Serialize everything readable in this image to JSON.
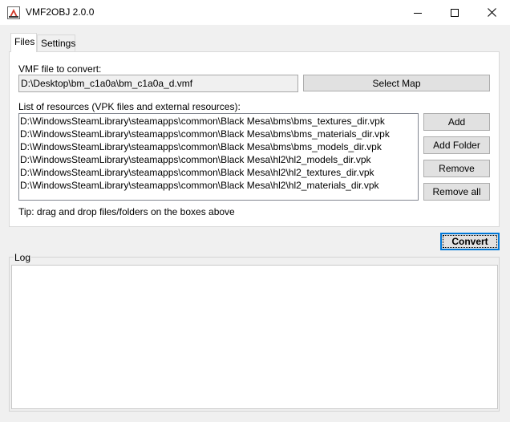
{
  "window": {
    "title": "VMF2OBJ 2.0.0"
  },
  "tabs": [
    {
      "label": "Files"
    },
    {
      "label": "Settings"
    }
  ],
  "files": {
    "vmf_label": "VMF file to convert:",
    "vmf_value": "D:\\Desktop\\bm_c1a0a\\bm_c1a0a_d.vmf",
    "select_map_label": "Select Map",
    "resources_label": "List of resources (VPK files and external resources):",
    "resources": [
      "D:\\WindowsSteamLibrary\\steamapps\\common\\Black Mesa\\bms\\bms_textures_dir.vpk",
      "D:\\WindowsSteamLibrary\\steamapps\\common\\Black Mesa\\bms\\bms_materials_dir.vpk",
      "D:\\WindowsSteamLibrary\\steamapps\\common\\Black Mesa\\bms\\bms_models_dir.vpk",
      "D:\\WindowsSteamLibrary\\steamapps\\common\\Black Mesa\\hl2\\hl2_models_dir.vpk",
      "D:\\WindowsSteamLibrary\\steamapps\\common\\Black Mesa\\hl2\\hl2_textures_dir.vpk",
      "D:\\WindowsSteamLibrary\\steamapps\\common\\Black Mesa\\hl2\\hl2_materials_dir.vpk"
    ],
    "add_label": "Add",
    "add_folder_label": "Add Folder",
    "remove_label": "Remove",
    "remove_all_label": "Remove all",
    "tip": "Tip: drag and drop files/folders on the boxes above"
  },
  "convert_label": "Convert",
  "log": {
    "label": "Log",
    "content": ""
  },
  "icons": {
    "app": "vmf2obj-app-icon",
    "minimize": "minimize-icon",
    "maximize": "maximize-icon",
    "close": "close-icon"
  },
  "colors": {
    "focus_border": "#0078d7",
    "window_bg": "#f0f0f0"
  }
}
